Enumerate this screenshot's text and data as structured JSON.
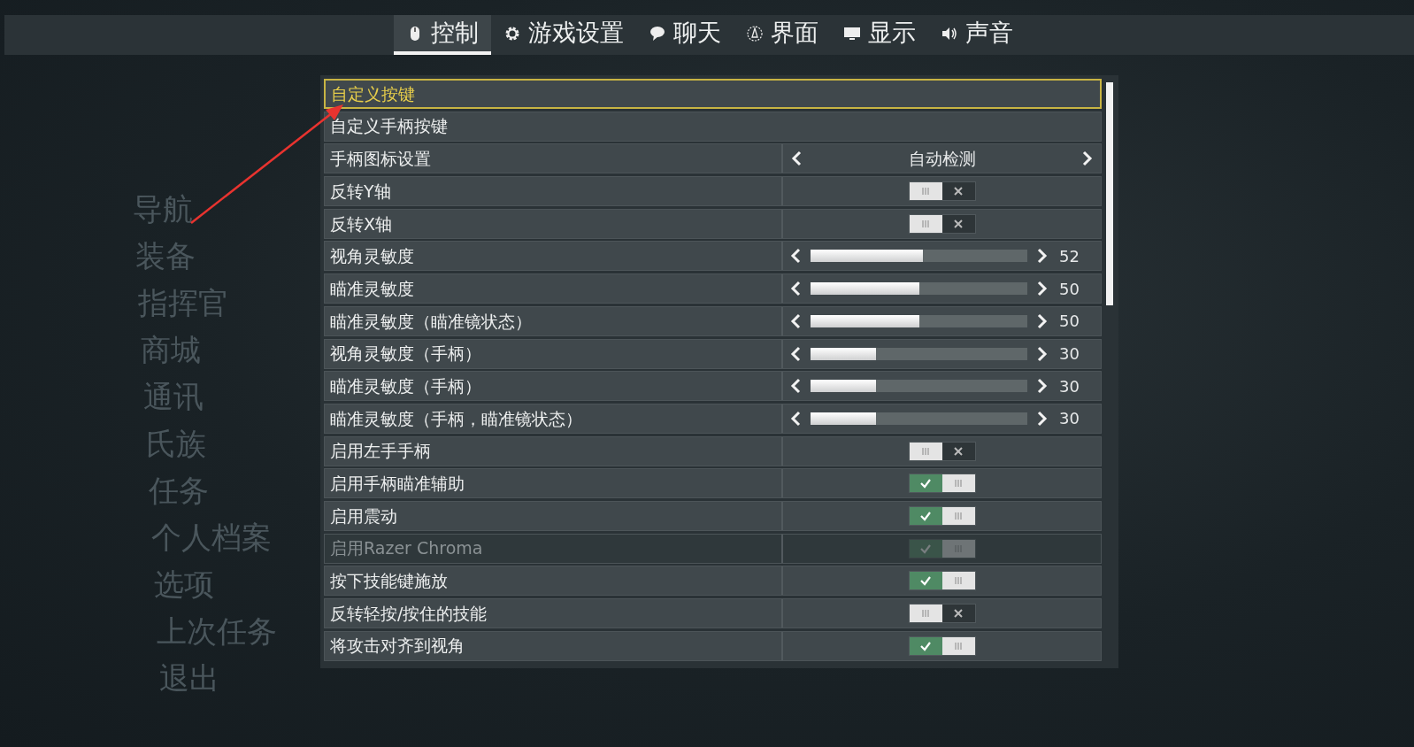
{
  "tabs": [
    {
      "label": "控制",
      "selected": true
    },
    {
      "label": "游戏设置",
      "selected": false
    },
    {
      "label": "聊天",
      "selected": false
    },
    {
      "label": "界面",
      "selected": false
    },
    {
      "label": "显示",
      "selected": false
    },
    {
      "label": "声音",
      "selected": false
    }
  ],
  "background_menu": [
    "导航",
    "装备",
    "指挥官",
    "商城",
    "通讯",
    "氏族",
    "任务",
    "个人档案",
    "选项",
    "上次任务",
    "退出"
  ],
  "settings": [
    {
      "kind": "link",
      "label": "自定义按键",
      "selected": true,
      "disabled": false
    },
    {
      "kind": "link",
      "label": "自定义手柄按键",
      "selected": false,
      "disabled": false
    },
    {
      "kind": "selector",
      "label": "手柄图标设置",
      "value": "自动检测",
      "selected": false,
      "disabled": false
    },
    {
      "kind": "toggle",
      "label": "反转Y轴",
      "on": false,
      "selected": false,
      "disabled": false
    },
    {
      "kind": "toggle",
      "label": "反转X轴",
      "on": false,
      "selected": false,
      "disabled": false
    },
    {
      "kind": "slider",
      "label": "视角灵敏度",
      "level": 0.52,
      "reading": "52",
      "selected": false,
      "disabled": false
    },
    {
      "kind": "slider",
      "label": "瞄准灵敏度",
      "level": 0.5,
      "reading": "50",
      "selected": false,
      "disabled": false
    },
    {
      "kind": "slider",
      "label": "瞄准灵敏度（瞄准镜状态）",
      "level": 0.5,
      "reading": "50",
      "selected": false,
      "disabled": false
    },
    {
      "kind": "slider",
      "label": "视角灵敏度（手柄）",
      "level": 0.3,
      "reading": "30",
      "selected": false,
      "disabled": false
    },
    {
      "kind": "slider",
      "label": "瞄准灵敏度（手柄）",
      "level": 0.3,
      "reading": "30",
      "selected": false,
      "disabled": false
    },
    {
      "kind": "slider",
      "label": "瞄准灵敏度（手柄，瞄准镜状态）",
      "level": 0.3,
      "reading": "30",
      "selected": false,
      "disabled": false
    },
    {
      "kind": "toggle",
      "label": "启用左手手柄",
      "on": false,
      "selected": false,
      "disabled": false
    },
    {
      "kind": "toggle",
      "label": "启用手柄瞄准辅助",
      "on": true,
      "selected": false,
      "disabled": false
    },
    {
      "kind": "toggle",
      "label": "启用震动",
      "on": true,
      "selected": false,
      "disabled": false
    },
    {
      "kind": "toggle",
      "label": "启用Razer Chroma",
      "on": true,
      "selected": false,
      "disabled": true
    },
    {
      "kind": "toggle",
      "label": "按下技能键施放",
      "on": true,
      "selected": false,
      "disabled": false
    },
    {
      "kind": "toggle",
      "label": "反转轻按/按住的技能",
      "on": false,
      "selected": false,
      "disabled": false
    },
    {
      "kind": "toggle",
      "label": "将攻击对齐到视角",
      "on": true,
      "selected": false,
      "disabled": false
    }
  ]
}
